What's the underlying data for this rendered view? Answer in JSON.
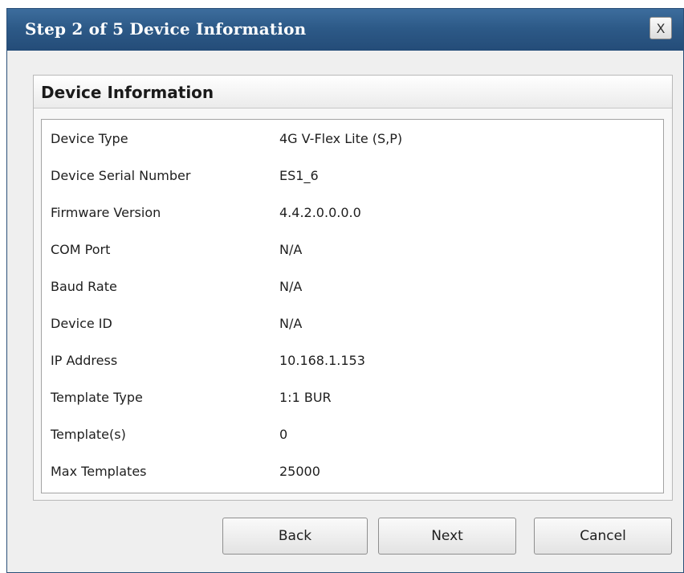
{
  "window": {
    "title": "Step 2 of 5 Device Information",
    "close_label": "X"
  },
  "panel": {
    "title": "Device Information",
    "rows": [
      {
        "label": "Device Type",
        "value": "4G V-Flex Lite (S,P)"
      },
      {
        "label": "Device Serial Number",
        "value": "ES1_6"
      },
      {
        "label": "Firmware Version",
        "value": "4.4.2.0.0.0.0"
      },
      {
        "label": "COM Port",
        "value": "N/A"
      },
      {
        "label": "Baud Rate",
        "value": "N/A"
      },
      {
        "label": "Device ID",
        "value": "N/A"
      },
      {
        "label": "IP Address",
        "value": "10.168.1.153"
      },
      {
        "label": "Template Type",
        "value": "1:1 BUR"
      },
      {
        "label": "Template(s)",
        "value": "0"
      },
      {
        "label": "Max Templates",
        "value": "25000"
      }
    ]
  },
  "buttons": {
    "back": "Back",
    "next": "Next",
    "cancel": "Cancel"
  }
}
